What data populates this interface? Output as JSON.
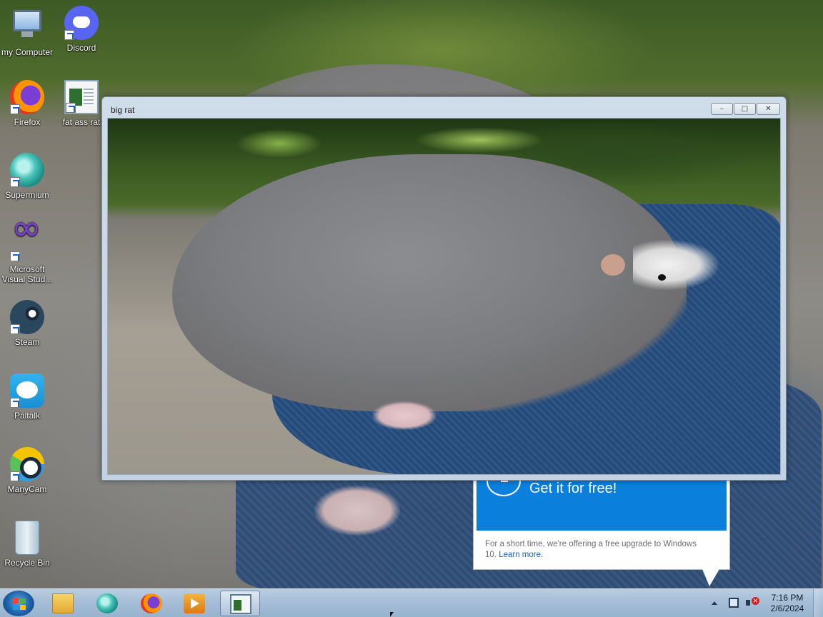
{
  "desktop": {
    "icons": [
      {
        "label": "my Computer",
        "icon": "computer-icon",
        "shortcut": false
      },
      {
        "label": "Discord",
        "icon": "discord-icon",
        "shortcut": true
      },
      {
        "label": "Firefox",
        "icon": "firefox-icon",
        "shortcut": true
      },
      {
        "label": "fat ass rat",
        "icon": "image-file-icon",
        "shortcut": true
      },
      {
        "label": "Supermium",
        "icon": "supermium-icon",
        "shortcut": true
      },
      {
        "label": "Microsoft Visual Stud...",
        "icon": "visual-studio-icon",
        "shortcut": true
      },
      {
        "label": "Steam",
        "icon": "steam-icon",
        "shortcut": true
      },
      {
        "label": "Paltalk",
        "icon": "paltalk-icon",
        "shortcut": true
      },
      {
        "label": "ManyCam",
        "icon": "manycam-icon",
        "shortcut": true
      },
      {
        "label": "Recycle Bin",
        "icon": "recycle-bin-icon",
        "shortcut": false
      }
    ]
  },
  "window": {
    "title": "big rat",
    "controls": {
      "minimize": "–",
      "maximize": "□",
      "close": "✕"
    },
    "content_description_icon": "rat-photo-image"
  },
  "promo": {
    "title": "Get it for free!",
    "body": "For a short time, we're offering a free upgrade to Windows 10.",
    "link": "Learn more."
  },
  "taskbar": {
    "apps": [
      {
        "name": "start-button",
        "icon": "windows-logo-icon"
      },
      {
        "name": "file-explorer",
        "icon": "folder-icon"
      },
      {
        "name": "supermium",
        "icon": "supermium-icon"
      },
      {
        "name": "firefox",
        "icon": "firefox-icon"
      },
      {
        "name": "media-player",
        "icon": "media-player-icon"
      },
      {
        "name": "image-viewer",
        "icon": "image-viewer-icon",
        "active": true
      }
    ],
    "clock": {
      "time": "7:16 PM",
      "date": "2/6/2024"
    }
  },
  "colors": {
    "taskbar": "#a7bfd7",
    "window_frame": "#c3d2e2",
    "promo_blue": "#0a7fdc",
    "link_blue": "#1a62c7"
  }
}
